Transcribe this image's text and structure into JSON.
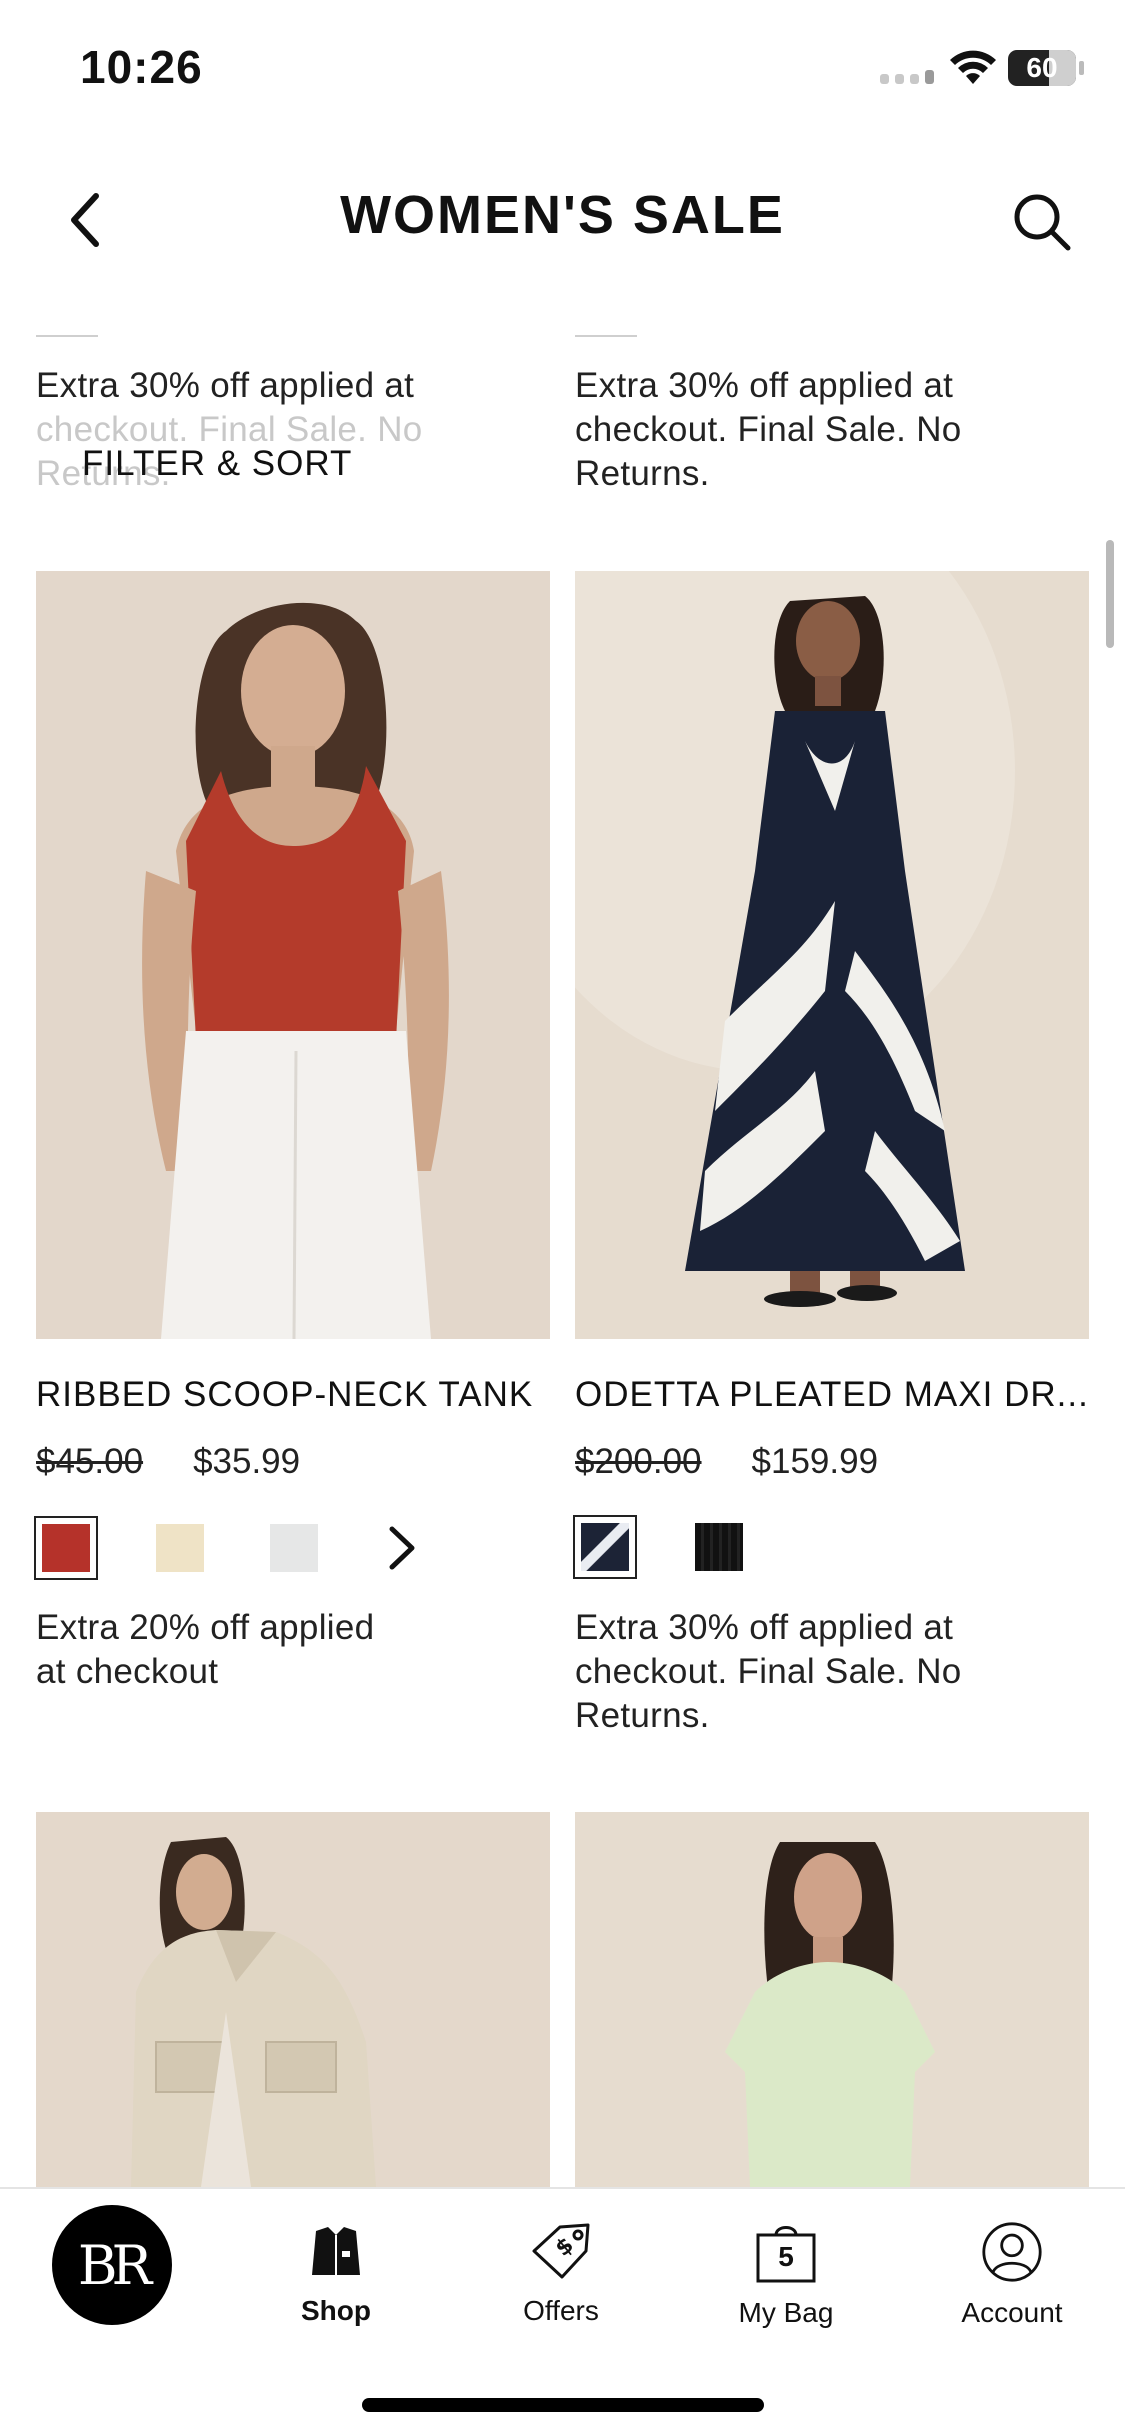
{
  "status_bar": {
    "time": "10:26",
    "battery": "60"
  },
  "header": {
    "title": "WOMEN'S SALE"
  },
  "filter_sort": {
    "label": "FILTER & SORT"
  },
  "top_row": {
    "left_promo": [
      "Extra 30% off applied at",
      "checkout. Final Sale. No",
      "Returns."
    ],
    "right_promo": [
      "Extra 30% off applied at",
      "checkout. Final Sale. No",
      "Returns."
    ]
  },
  "products": [
    {
      "name": "RIBBED SCOOP-NECK TANK",
      "price_old": "$45.00",
      "price_new": "$35.99",
      "swatches": [
        "#b5322a",
        "#efe3c6",
        "#e6e7e7"
      ],
      "has_more_swatches": true,
      "promo": [
        "Extra 20% off applied",
        "at checkout"
      ],
      "image": "woman-red-tank-white-jeans"
    },
    {
      "name": "ODETTA PLEATED MAXI DR...",
      "price_old": "$200.00",
      "price_new": "$159.99",
      "swatches": [
        "#1c2336",
        "#111111"
      ],
      "has_more_swatches": false,
      "promo": [
        "Extra 30% off applied at",
        "checkout. Final Sale. No",
        "Returns."
      ],
      "image": "woman-navy-print-maxi-dress"
    },
    {
      "image": "woman-beige-utility-jacket"
    },
    {
      "image": "woman-mint-tshirt-dress"
    }
  ],
  "bottom_nav": {
    "logo": "BR",
    "items": [
      {
        "label": "Shop",
        "icon": "shop-jacket-icon"
      },
      {
        "label": "Offers",
        "icon": "offer-tag-icon"
      },
      {
        "label": "My Bag",
        "icon": "shopping-bag-icon",
        "count": "5"
      },
      {
        "label": "Account",
        "icon": "account-icon"
      }
    ]
  }
}
